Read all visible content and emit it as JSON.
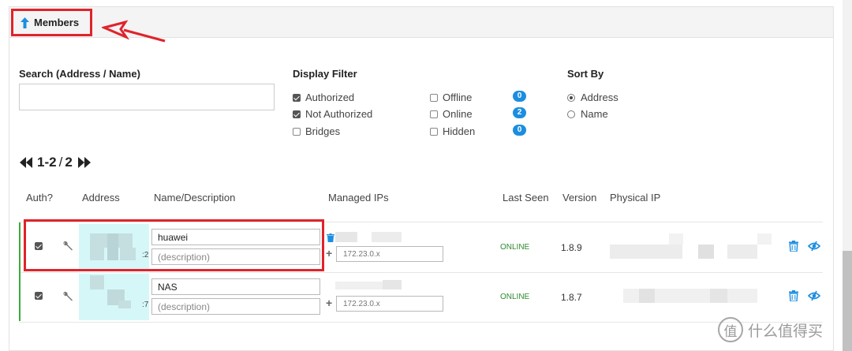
{
  "panel": {
    "title": "Members"
  },
  "search": {
    "label": "Search (Address / Name)",
    "value": "",
    "placeholder": ""
  },
  "display_filter": {
    "label": "Display Filter",
    "authorized": {
      "label": "Authorized",
      "checked": true
    },
    "not_authorized": {
      "label": "Not Authorized",
      "checked": true
    },
    "bridges": {
      "label": "Bridges",
      "checked": false
    },
    "offline": {
      "label": "Offline",
      "checked": false,
      "count": "0"
    },
    "online": {
      "label": "Online",
      "checked": false,
      "count": "2"
    },
    "hidden": {
      "label": "Hidden",
      "checked": false,
      "count": "0"
    }
  },
  "sort_by": {
    "label": "Sort By",
    "address": {
      "label": "Address",
      "selected": true
    },
    "name": {
      "label": "Name",
      "selected": false
    }
  },
  "pager": {
    "range": "1-2",
    "separator": "/",
    "total": "2"
  },
  "table": {
    "headers": {
      "auth": "Auth?",
      "address": "Address",
      "name": "Name/Description",
      "managed_ips": "Managed IPs",
      "last_seen": "Last Seen",
      "version": "Version",
      "physical_ip": "Physical IP"
    },
    "rows": [
      {
        "authorized": true,
        "address_suffix": ":2",
        "name": "huawei",
        "description": "",
        "description_placeholder": "(description)",
        "ip_placeholder": "172.23.0.x",
        "last_seen": "ONLINE",
        "version": "1.8.9"
      },
      {
        "authorized": true,
        "address_suffix": ":7",
        "name": "NAS",
        "description": "",
        "description_placeholder": "(description)",
        "ip_placeholder": "172.23.0.x",
        "last_seen": "ONLINE",
        "version": "1.8.7"
      }
    ]
  },
  "watermark": {
    "mark": "值",
    "text": "什么值得买"
  },
  "colors": {
    "accent": "#1c8ee0",
    "annotation_red": "#e0232b",
    "online_green": "#2f8a2f",
    "auth_bar": "#3bab3b"
  }
}
